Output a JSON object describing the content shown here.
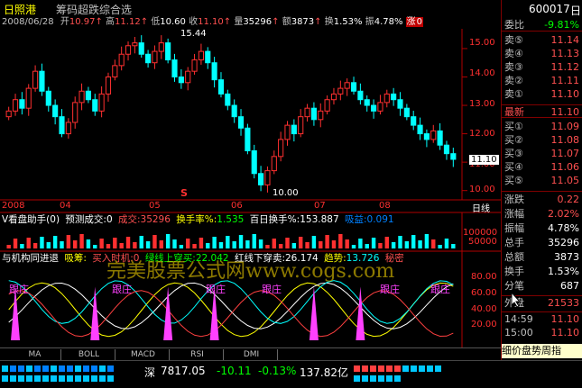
{
  "window": {
    "stock_name": "日照港",
    "panel_title": "筹码超跌综合选",
    "stock_code": "600017",
    "stock_code_short": "日"
  },
  "info_row": {
    "date": "2008/06/28",
    "open_label": "开",
    "open": "10.97",
    "high_label": "高",
    "high": "11.12",
    "low_label": "低",
    "low": "10.60",
    "close_label": "收",
    "close": "11.10",
    "vol_label": "量",
    "vol": "35296",
    "amount_label": "额",
    "amount": "3873",
    "turnover_label": "换",
    "turnover": "1.53%",
    "amp_label": "振",
    "amp": "4.78%",
    "chg_label": "涨",
    "chg": "0"
  },
  "price_axis": [
    "15.00",
    "14.00",
    "13.00",
    "12.00",
    "11.00",
    "10.00"
  ],
  "price_tag": "11.10",
  "annotations": {
    "high_mark": "15.44",
    "low_mark": "10.00",
    "s_mark": "S"
  },
  "time_axis": [
    "2008",
    "04",
    "05",
    "06",
    "07",
    "08"
  ],
  "time_axis_label": "日线",
  "indicator1": {
    "name": "V看盘助手(0)",
    "predict_label": "预测成交:0",
    "vol_label": "成交:",
    "vol": "35296",
    "turn_label": "换手率%:",
    "turn": "1.535",
    "hundred_label": "百日换手%:",
    "hundred": "153.887",
    "absorb_label": "吸益:",
    "absorb": "0.091",
    "axis_top": "100000",
    "axis_mid": "50000"
  },
  "indicator2": {
    "name": "与机构同进退",
    "absorb_label": "吸筹:",
    "buy_label": "买入时机:",
    "buy": "0",
    "green_label": "绿线上穿买:",
    "green": "22.042",
    "red_label": "红线下穿卖:",
    "red": "26.174",
    "trend_label": "趋势:",
    "trend": "13.726",
    "secret_label": "秘密",
    "follow_label": "跟庄",
    "follow_labels": [
      "跟庄",
      "跟庄",
      "跟庄",
      "跟庄",
      "跟庄",
      "跟庄"
    ],
    "axis": [
      "80.00",
      "60.00",
      "40.00",
      "20.00"
    ]
  },
  "watermark": "完美股票公式网www.cogs.com",
  "tabs": [
    "MA",
    "BOLL",
    "MACD",
    "RSI",
    "DMI"
  ],
  "right_panel": {
    "ratio_label": "委比",
    "ratio": "-9.81%",
    "asks": [
      {
        "label": "卖⑤",
        "price": "11.14"
      },
      {
        "label": "卖④",
        "price": "11.13"
      },
      {
        "label": "卖③",
        "price": "11.12"
      },
      {
        "label": "卖②",
        "price": "11.11"
      },
      {
        "label": "卖①",
        "price": "11.10"
      }
    ],
    "last_label": "最新",
    "last": "11.10",
    "bids": [
      {
        "label": "买①",
        "price": "11.09"
      },
      {
        "label": "买②",
        "price": "11.08"
      },
      {
        "label": "买③",
        "price": "11.07"
      },
      {
        "label": "买④",
        "price": "11.06"
      },
      {
        "label": "买⑤",
        "price": "11.05"
      }
    ],
    "stats": [
      {
        "label": "涨跌",
        "value": "0.22"
      },
      {
        "label": "涨幅",
        "value": "2.02%"
      },
      {
        "label": "振幅",
        "value": "4.78%"
      },
      {
        "label": "总手",
        "value": "35296"
      },
      {
        "label": "总额",
        "value": "3873"
      },
      {
        "label": "换手",
        "value": "1.53%"
      },
      {
        "label": "分笔",
        "value": "687"
      }
    ],
    "outer_label": "外盘",
    "outer": "21533",
    "ticks": [
      {
        "time": "14:59",
        "price": "11.10"
      },
      {
        "time": "15:00",
        "price": "11.10"
      }
    ],
    "footer_tabs": "细价盘势周指"
  },
  "statusbar": {
    "market": "深",
    "index": "7817.05",
    "change": "-10.11",
    "pct": "-0.13%",
    "amount": "137.82亿"
  },
  "chart_data": {
    "type": "candlestick",
    "x": [
      "2008-01",
      "2008-04",
      "2008-05",
      "2008-06",
      "2008-07",
      "2008-08"
    ],
    "ylim": [
      9.8,
      15.6
    ],
    "close": [
      12.8,
      13.2,
      12.9,
      13.6,
      14.2,
      13.5,
      13.0,
      12.6,
      12.0,
      12.4,
      13.1,
      13.5,
      13.2,
      12.8,
      13.4,
      14.0,
      14.4,
      14.8,
      15.1,
      15.2,
      14.8,
      14.5,
      14.9,
      15.2,
      14.6,
      14.0,
      13.8,
      14.2,
      14.6,
      14.9,
      14.5,
      13.9,
      13.4,
      13.0,
      12.6,
      12.2,
      11.4,
      10.6,
      10.2,
      10.7,
      11.2,
      11.8,
      12.3,
      12.0,
      12.6,
      12.9,
      12.5,
      12.8,
      13.2,
      13.4,
      13.6,
      13.8,
      13.5,
      13.2,
      13.0,
      12.8,
      13.1,
      13.4,
      13.2,
      12.9,
      12.6,
      12.3,
      12.0,
      11.8,
      12.1,
      11.6,
      11.3,
      11.1
    ]
  }
}
